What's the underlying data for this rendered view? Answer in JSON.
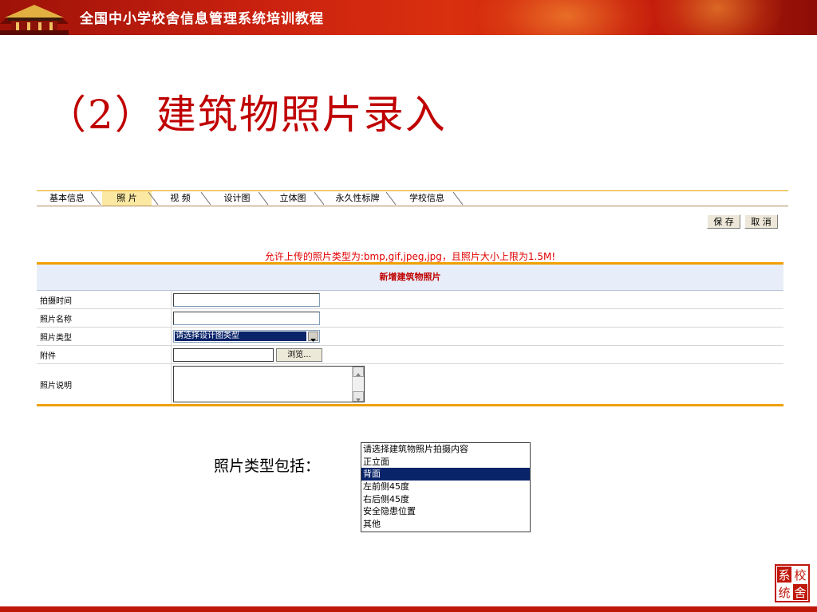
{
  "header": {
    "title": "全国中小学校舍信息管理系统培训教程"
  },
  "slide": {
    "title": "（2）建筑物照片录入"
  },
  "tabs": [
    {
      "label": "基本信息"
    },
    {
      "label": "照  片"
    },
    {
      "label": "视  频"
    },
    {
      "label": "设计图"
    },
    {
      "label": "立体图"
    },
    {
      "label": "永久性标牌"
    },
    {
      "label": "学校信息"
    }
  ],
  "toolbar": {
    "save_label": "保 存",
    "cancel_label": "取 消"
  },
  "notice": "允许上传的照片类型为:bmp,gif,jpeg,jpg，且照片大小上限为1.5M!",
  "form": {
    "header": "新增建筑物照片",
    "fields": {
      "shoot_time_label": "拍摄时间",
      "photo_name_label": "照片名称",
      "photo_type_label": "照片类型",
      "photo_type_value": "请选择设计图类型",
      "attachment_label": "附件",
      "browse_label": "浏览...",
      "description_label": "照片说明"
    }
  },
  "caption": "照片类型包括：",
  "photo_type_options": [
    {
      "label": "请选择建筑物照片拍摄内容",
      "selected": false
    },
    {
      "label": "正立面",
      "selected": false
    },
    {
      "label": "背面",
      "selected": true
    },
    {
      "label": "左前侧45度",
      "selected": false
    },
    {
      "label": "右后侧45度",
      "selected": false
    },
    {
      "label": "安全隐患位置",
      "selected": false
    },
    {
      "label": "其他",
      "selected": false
    }
  ],
  "logo": {
    "chars": [
      "系",
      "校",
      "统",
      "舍"
    ]
  },
  "colors": {
    "banner_red": "#c8200f",
    "title_red": "#c00000",
    "accent_orange": "#f0a000",
    "selection_blue": "#0a246a"
  }
}
